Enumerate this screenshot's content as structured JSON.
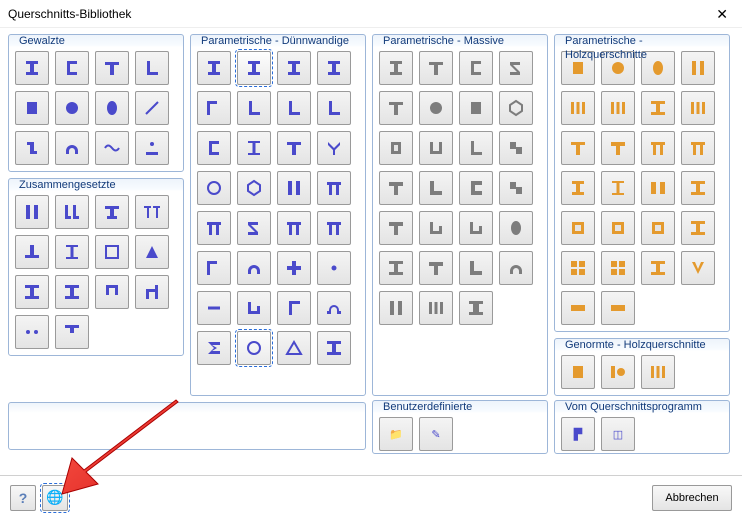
{
  "window": {
    "title": "Querschnitts-Bibliothek"
  },
  "groups": {
    "gewalzte": {
      "title": "Gewalzte"
    },
    "zusammen": {
      "title": "Zusammengesetzte"
    },
    "thin": {
      "title": "Parametrische - Dünnwandige"
    },
    "massive": {
      "title": "Parametrische - Massive"
    },
    "holz": {
      "title": "Parametrische - Holzquerschnitte"
    },
    "genormte": {
      "title": "Genormte - Holzquerschnitte"
    },
    "benutzer": {
      "title": "Benutzerdefinierte"
    },
    "vomprog": {
      "title": "Vom Querschnittsprogramm"
    }
  },
  "buttons": {
    "cancel": "Abbrechen"
  },
  "icons": {
    "help": "?",
    "globe": "🌐",
    "folder": "📁",
    "edit": "✎",
    "prog1": "▛",
    "prog2": "◫"
  },
  "shapes": {
    "gewalzte": [
      "I",
      "C",
      "T",
      "L",
      "rect",
      "circle",
      "oval",
      "angle",
      "z",
      "omega",
      "wave",
      "dot-top"
    ],
    "zusammen": [
      "II",
      "IL",
      "Tb",
      "TT",
      "Tn",
      "I2",
      "frame",
      "wedge",
      "Ib",
      "Ic",
      "cap",
      "clamp",
      "dots",
      "Ts"
    ],
    "thin": [
      "I",
      "I",
      "I",
      "I",
      "Tl",
      "L",
      "L",
      "L",
      "C",
      "I2",
      "T",
      "Y",
      "O",
      "hex",
      "II",
      "pi",
      "pibold",
      "Z",
      "pi2",
      "pi3",
      "Tl",
      "omega",
      "plus",
      "dot",
      "minus",
      "ch",
      "Lm",
      "omega2",
      "sigma",
      "O2",
      "tri",
      "I3"
    ],
    "massive": [
      "I",
      "T",
      "C",
      "Z",
      "T",
      "circle",
      "rect",
      "hex",
      "tube",
      "U",
      "L",
      "step",
      "T2",
      "L2",
      "C2",
      "step2",
      "T3",
      "ch",
      "ch2",
      "oval",
      "I4",
      "T4",
      "L3",
      "omega",
      "II",
      "III",
      "Ir"
    ],
    "holz": [
      "rect",
      "circle",
      "oval",
      "II",
      "III",
      "III2",
      "I3",
      "III3",
      "T",
      "T2",
      "pi",
      "pi2",
      "I",
      "I2",
      "II2",
      "Ib",
      "box",
      "box2",
      "box3",
      "Ic",
      "grid",
      "grid2",
      "Is",
      "V",
      "bar",
      "bar2"
    ],
    "genormte": [
      "rect",
      "IO",
      "III"
    ]
  }
}
